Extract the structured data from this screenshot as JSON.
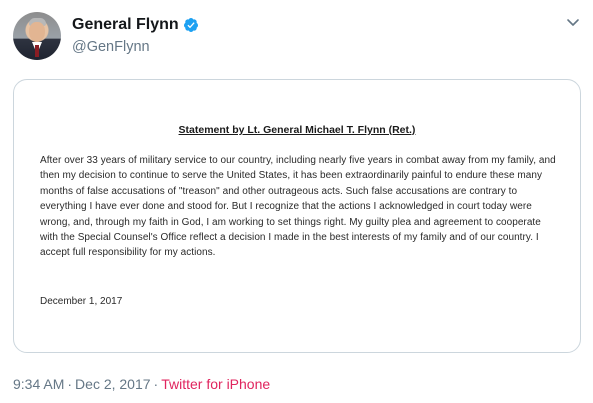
{
  "user": {
    "display_name": "General Flynn",
    "handle": "@GenFlynn",
    "verified": true,
    "avatar_icon": "profile-photo"
  },
  "media": {
    "title": "Statement by Lt. General Michael T. Flynn (Ret.)",
    "body": "After over 33 years of military service to our country, including nearly five years in combat away from my family, and then my decision to continue to serve the United States, it has been extraordinarily painful to endure these many months of false accusations of \"treason\" and other outrageous acts.  Such false accusations are contrary to everything I have ever done and stood for.  But I recognize that the actions I acknowledged in court today were wrong, and, through my faith in God, I am working to set things right.  My guilty plea and agreement to cooperate with the Special Counsel's Office reflect a decision I made in the best interests of my family and of our country.  I accept full responsibility for my actions.",
    "date": "December 1, 2017"
  },
  "meta": {
    "time": "9:34 AM",
    "separator": "·",
    "date": "Dec 2, 2017",
    "source": "Twitter for iPhone"
  },
  "colors": {
    "verified": "#1da1f2",
    "source_link": "#e0245e",
    "secondary_text": "#657786"
  }
}
